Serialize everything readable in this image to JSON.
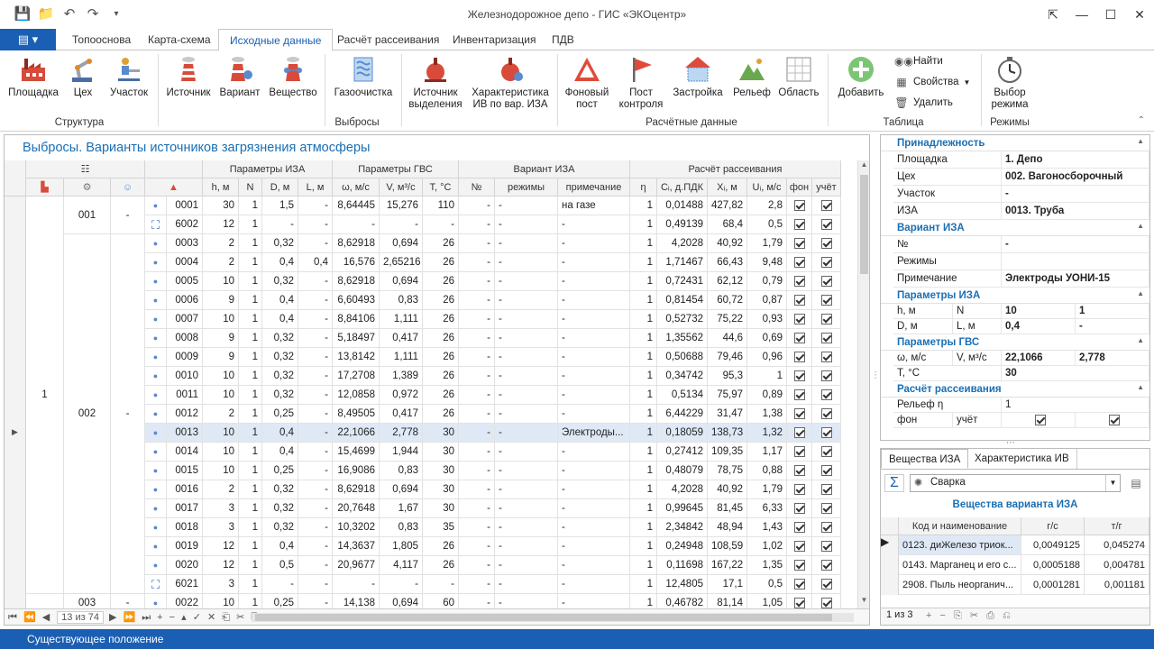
{
  "window": {
    "title": "Железнодорожное депо - ГИС «ЭКОцентр»"
  },
  "ribbon_tabs": [
    "Топооснова",
    "Карта-схема",
    "Исходные данные",
    "Расчёт рассеивания",
    "Инвентаризация",
    "ПДВ"
  ],
  "ribbon": {
    "groups": [
      "Структура",
      "Выбросы",
      "Расчётные данные",
      "Таблица",
      "Режимы"
    ],
    "buttons": {
      "ploshadka": "Площадка",
      "ceh": "Цех",
      "uchastok": "Участок",
      "istochnik": "Источник",
      "variant": "Вариант",
      "veshestvo": "Вещество",
      "gazoochistka": "Газоочистка",
      "istochnik_vydeleniya": [
        "Источник",
        "выделения"
      ],
      "harakteristika": [
        "Характеристика",
        "ИВ по вар. ИЗА"
      ],
      "fonovyi": [
        "Фоновый",
        "пост"
      ],
      "post_kontrolya": [
        "Пост",
        "контроля"
      ],
      "zastroyka": "Застройка",
      "relief": "Рельеф",
      "oblast": "Область",
      "dobavit": "Добавить",
      "nayti": "Найти",
      "svoistva": "Свойства",
      "udalit": "Удалить",
      "vybor": [
        "Выбор",
        "режима"
      ]
    }
  },
  "grid": {
    "title": "Выбросы. Варианты источников загрязнения атмосферы",
    "groups": {
      "params_iza": "Параметры ИЗА",
      "params_gvs": "Параметры ГВС",
      "variant_iza": "Вариант ИЗА",
      "rasschet": "Расчёт рассеивания"
    },
    "columns": [
      "h, м",
      "N",
      "D, м",
      "L, м",
      "ω, м/с",
      "V, м³/с",
      "T, °C",
      "№",
      "режимы",
      "примечание",
      "η",
      "Cᵢ, д.ПДК",
      "Xᵢ, м",
      "Uᵢ, м/с",
      "фон",
      "учёт"
    ],
    "ploshadka": "1",
    "ceh_001": "001",
    "ceh_002": "002",
    "ceh_003": "003",
    "uch_001": "-",
    "uch_002": "-",
    "uch_003": "-",
    "rows": [
      {
        "iza": "0001",
        "h": "30",
        "n": "1",
        "d": "1,5",
        "l": "-",
        "w": "8,64445",
        "v": "15,276",
        "t": "110",
        "num": "-",
        "rej": "-",
        "prim": "на газе",
        "eta": "1",
        "c": "0,01488",
        "x": "427,82",
        "u": "2,8"
      },
      {
        "iza": "6002",
        "h": "12",
        "n": "1",
        "d": "-",
        "l": "-",
        "w": "-",
        "v": "-",
        "t": "-",
        "num": "-",
        "rej": "-",
        "prim": "-",
        "eta": "1",
        "c": "0,49139",
        "x": "68,4",
        "u": "0,5"
      },
      {
        "iza": "0003",
        "h": "2",
        "n": "1",
        "d": "0,32",
        "l": "-",
        "w": "8,62918",
        "v": "0,694",
        "t": "26",
        "num": "-",
        "rej": "-",
        "prim": "-",
        "eta": "1",
        "c": "4,2028",
        "x": "40,92",
        "u": "1,79"
      },
      {
        "iza": "0004",
        "h": "2",
        "n": "1",
        "d": "0,4",
        "l": "0,4",
        "w": "16,576",
        "v": "2,65216",
        "t": "26",
        "num": "-",
        "rej": "-",
        "prim": "-",
        "eta": "1",
        "c": "1,71467",
        "x": "66,43",
        "u": "9,48"
      },
      {
        "iza": "0005",
        "h": "10",
        "n": "1",
        "d": "0,32",
        "l": "-",
        "w": "8,62918",
        "v": "0,694",
        "t": "26",
        "num": "-",
        "rej": "-",
        "prim": "-",
        "eta": "1",
        "c": "0,72431",
        "x": "62,12",
        "u": "0,79"
      },
      {
        "iza": "0006",
        "h": "9",
        "n": "1",
        "d": "0,4",
        "l": "-",
        "w": "6,60493",
        "v": "0,83",
        "t": "26",
        "num": "-",
        "rej": "-",
        "prim": "-",
        "eta": "1",
        "c": "0,81454",
        "x": "60,72",
        "u": "0,87"
      },
      {
        "iza": "0007",
        "h": "10",
        "n": "1",
        "d": "0,4",
        "l": "-",
        "w": "8,84106",
        "v": "1,111",
        "t": "26",
        "num": "-",
        "rej": "-",
        "prim": "-",
        "eta": "1",
        "c": "0,52732",
        "x": "75,22",
        "u": "0,93"
      },
      {
        "iza": "0008",
        "h": "9",
        "n": "1",
        "d": "0,32",
        "l": "-",
        "w": "5,18497",
        "v": "0,417",
        "t": "26",
        "num": "-",
        "rej": "-",
        "prim": "-",
        "eta": "1",
        "c": "1,35562",
        "x": "44,6",
        "u": "0,69"
      },
      {
        "iza": "0009",
        "h": "9",
        "n": "1",
        "d": "0,32",
        "l": "-",
        "w": "13,8142",
        "v": "1,111",
        "t": "26",
        "num": "-",
        "rej": "-",
        "prim": "-",
        "eta": "1",
        "c": "0,50688",
        "x": "79,46",
        "u": "0,96"
      },
      {
        "iza": "0010",
        "h": "10",
        "n": "1",
        "d": "0,32",
        "l": "-",
        "w": "17,2708",
        "v": "1,389",
        "t": "26",
        "num": "-",
        "rej": "-",
        "prim": "-",
        "eta": "1",
        "c": "0,34742",
        "x": "95,3",
        "u": "1"
      },
      {
        "iza": "0011",
        "h": "10",
        "n": "1",
        "d": "0,32",
        "l": "-",
        "w": "12,0858",
        "v": "0,972",
        "t": "26",
        "num": "-",
        "rej": "-",
        "prim": "-",
        "eta": "1",
        "c": "0,5134",
        "x": "75,97",
        "u": "0,89"
      },
      {
        "iza": "0012",
        "h": "2",
        "n": "1",
        "d": "0,25",
        "l": "-",
        "w": "8,49505",
        "v": "0,417",
        "t": "26",
        "num": "-",
        "rej": "-",
        "prim": "-",
        "eta": "1",
        "c": "6,44229",
        "x": "31,47",
        "u": "1,38"
      },
      {
        "iza": "0013",
        "h": "10",
        "n": "1",
        "d": "0,4",
        "l": "-",
        "w": "22,1066",
        "v": "2,778",
        "t": "30",
        "num": "-",
        "rej": "-",
        "prim": "Электроды...",
        "eta": "1",
        "c": "0,18059",
        "x": "138,73",
        "u": "1,32"
      },
      {
        "iza": "0014",
        "h": "10",
        "n": "1",
        "d": "0,4",
        "l": "-",
        "w": "15,4699",
        "v": "1,944",
        "t": "30",
        "num": "-",
        "rej": "-",
        "prim": "-",
        "eta": "1",
        "c": "0,27412",
        "x": "109,35",
        "u": "1,17"
      },
      {
        "iza": "0015",
        "h": "10",
        "n": "1",
        "d": "0,25",
        "l": "-",
        "w": "16,9086",
        "v": "0,83",
        "t": "30",
        "num": "-",
        "rej": "-",
        "prim": "-",
        "eta": "1",
        "c": "0,48079",
        "x": "78,75",
        "u": "0,88"
      },
      {
        "iza": "0016",
        "h": "2",
        "n": "1",
        "d": "0,32",
        "l": "-",
        "w": "8,62918",
        "v": "0,694",
        "t": "30",
        "num": "-",
        "rej": "-",
        "prim": "-",
        "eta": "1",
        "c": "4,2028",
        "x": "40,92",
        "u": "1,79"
      },
      {
        "iza": "0017",
        "h": "3",
        "n": "1",
        "d": "0,32",
        "l": "-",
        "w": "20,7648",
        "v": "1,67",
        "t": "30",
        "num": "-",
        "rej": "-",
        "prim": "-",
        "eta": "1",
        "c": "0,99645",
        "x": "81,45",
        "u": "6,33"
      },
      {
        "iza": "0018",
        "h": "3",
        "n": "1",
        "d": "0,32",
        "l": "-",
        "w": "10,3202",
        "v": "0,83",
        "t": "35",
        "num": "-",
        "rej": "-",
        "prim": "-",
        "eta": "1",
        "c": "2,34842",
        "x": "48,94",
        "u": "1,43"
      },
      {
        "iza": "0019",
        "h": "12",
        "n": "1",
        "d": "0,4",
        "l": "-",
        "w": "14,3637",
        "v": "1,805",
        "t": "26",
        "num": "-",
        "rej": "-",
        "prim": "-",
        "eta": "1",
        "c": "0,24948",
        "x": "108,59",
        "u": "1,02"
      },
      {
        "iza": "0020",
        "h": "12",
        "n": "1",
        "d": "0,5",
        "l": "-",
        "w": "20,9677",
        "v": "4,117",
        "t": "26",
        "num": "-",
        "rej": "-",
        "prim": "-",
        "eta": "1",
        "c": "0,11698",
        "x": "167,22",
        "u": "1,35"
      },
      {
        "iza": "6021",
        "h": "3",
        "n": "1",
        "d": "-",
        "l": "-",
        "w": "-",
        "v": "-",
        "t": "-",
        "num": "-",
        "rej": "-",
        "prim": "-",
        "eta": "1",
        "c": "12,4805",
        "x": "17,1",
        "u": "0,5"
      },
      {
        "iza": "0022",
        "h": "10",
        "n": "1",
        "d": "0,25",
        "l": "-",
        "w": "14,138",
        "v": "0,694",
        "t": "60",
        "num": "-",
        "rej": "-",
        "prim": "-",
        "eta": "1",
        "c": "0,46782",
        "x": "81,14",
        "u": "1,05"
      }
    ],
    "nav_counter": "13 из 74"
  },
  "props": {
    "cat1": "Принадлежность",
    "cat1_rows": [
      [
        "Площадка",
        "1. Депо"
      ],
      [
        "Цех",
        "002. Вагоносборочный"
      ],
      [
        "Участок",
        "-"
      ],
      [
        "ИЗА",
        "0013. Труба"
      ]
    ],
    "cat2": "Вариант ИЗА",
    "cat2_rows": [
      [
        "№",
        "-"
      ],
      [
        "Режимы",
        ""
      ],
      [
        "Примечание",
        "Электроды УОНИ-15"
      ]
    ],
    "cat3": "Параметры ИЗА",
    "p_h": "h, м",
    "p_n": "N",
    "p_d": "D, м",
    "p_l": "L, м",
    "v_h": "10",
    "v_n": "1",
    "v_d": "0,4",
    "v_l": "-",
    "cat4": "Параметры ГВС",
    "p_w": "ω, м/с",
    "p_v": "V, м³/с",
    "p_t": "T, °C",
    "v_w": "22,1066",
    "v_v": "2,778",
    "v_t": "30",
    "cat5": "Расчёт рассеивания",
    "p_relief": "Рельеф η",
    "v_relief": "1",
    "p_fon": "фон",
    "p_uchet": "учёт"
  },
  "substances": {
    "tabs": [
      "Вещества ИЗА",
      "Характеристика ИВ"
    ],
    "combo": "Сварка",
    "title": "Вещества варианта ИЗА",
    "columns": [
      "Код и наименование",
      "г/с",
      "т/г"
    ],
    "rows": [
      [
        "0123. диЖелезо триок...",
        "0,0049125",
        "0,045274"
      ],
      [
        "0143. Марганец и его с...",
        "0,0005188",
        "0,004781"
      ],
      [
        "2908. Пыль неорганич...",
        "0,0001281",
        "0,001181"
      ]
    ],
    "nav_counter": "1 из 3"
  },
  "status": "Существующее положение"
}
